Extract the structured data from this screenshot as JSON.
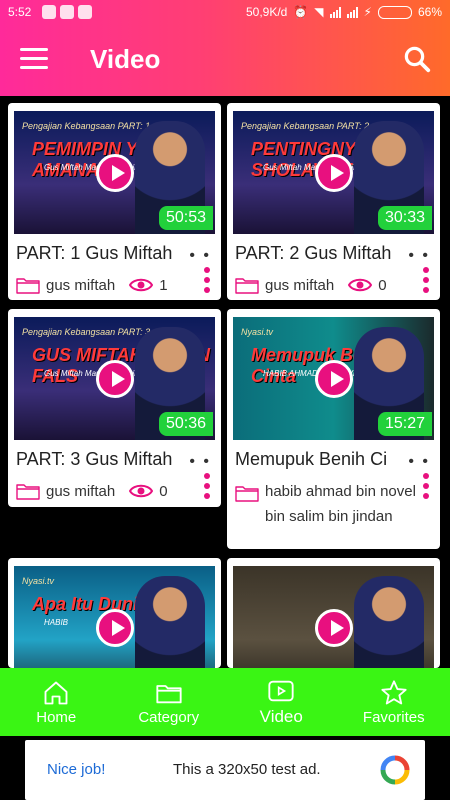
{
  "status": {
    "time": "5:52",
    "network_speed": "50,9K/d",
    "battery_percent": "66%",
    "battery_level": 0.66
  },
  "appbar": {
    "title": "Video",
    "menu_icon": "menu-icon",
    "search_icon": "search-icon"
  },
  "videos": [
    {
      "title": "PART: 1 Gus Miftah",
      "duration": "50:53",
      "category": "gus miftah",
      "views": "1",
      "thumb_line1": "Pengajian Kebangsaan PART: 1",
      "thumb_line2": "PEMIMPIN YANG AMANAH",
      "thumb_line3": "Gus Miftah Maulana Habib"
    },
    {
      "title": "PART: 2 Gus Miftah",
      "duration": "30:33",
      "category": "gus miftah",
      "views": "0",
      "thumb_line1": "Pengajian Kebangsaan PART: 2",
      "thumb_line2": "PENTINGNYA SHOLAWAT",
      "thumb_line3": "Gus Miftah Maulana Habib"
    },
    {
      "title": "PART: 3 Gus Miftah",
      "duration": "50:36",
      "category": "gus miftah",
      "views": "0",
      "thumb_line1": "Pengajian Kebangsaan PART: 3",
      "thumb_line2": "GUS MIFTAH ADZAN FALS",
      "thumb_line3": "Gus Miftah Maulana Habib"
    },
    {
      "title": "Memupuk Benih Ci",
      "duration": "15:27",
      "category": "habib ahmad bin novel bin salim bin jindan",
      "views": "",
      "thumb_line1": "Nyasi.tv",
      "thumb_line2": "Memupuk Benih Cinta",
      "thumb_line3": "HABIB AHMAD BIN NOVEL JINDAN"
    },
    {
      "title": "",
      "duration": "",
      "category": "",
      "views": "",
      "thumb_line1": "Nyasi.tv",
      "thumb_line2": "Apa Itu Dunia",
      "thumb_line3": "HABIB"
    },
    {
      "title": "",
      "duration": "",
      "category": "",
      "views": "",
      "thumb_line1": "",
      "thumb_line2": "",
      "thumb_line3": ""
    }
  ],
  "bottom_nav": [
    {
      "label": "Home",
      "icon": "home-icon",
      "active": false
    },
    {
      "label": "Category",
      "icon": "folder-icon",
      "active": false
    },
    {
      "label": "Video",
      "icon": "video-icon",
      "active": true
    },
    {
      "label": "Favorites",
      "icon": "star-icon",
      "active": false
    }
  ],
  "ad": {
    "nice_label": "Nice job!",
    "text": "This a 320x50 test ad."
  },
  "colors": {
    "accent_pink": "#e8107f",
    "nav_green": "#3af514",
    "duration_green": "#22d13b"
  }
}
